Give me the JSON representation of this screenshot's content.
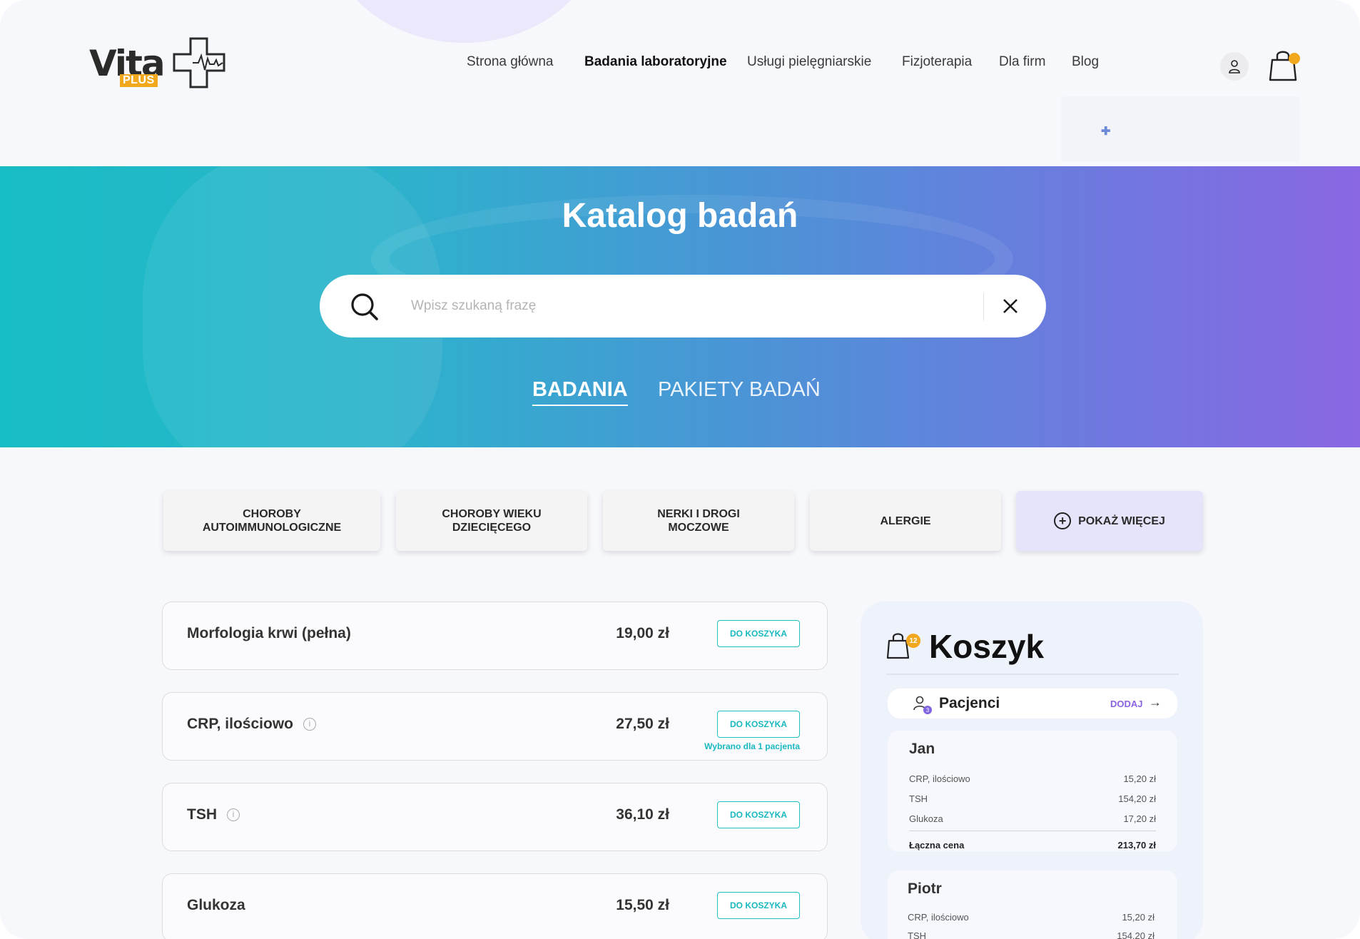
{
  "brand": {
    "name": "Vita",
    "sub": "PLUS"
  },
  "nav": {
    "items": [
      {
        "label": "Strona główna"
      },
      {
        "label": "Badania laboratoryjne"
      },
      {
        "label": "Usługi pielęgniarskie"
      },
      {
        "label": "Fizjoterapia"
      },
      {
        "label": "Dla firm"
      },
      {
        "label": "Blog"
      }
    ],
    "active_index": 1
  },
  "icons": {
    "user": "user-icon",
    "cart": "shopping-bag-icon",
    "search": "search-icon",
    "clear": "close-icon",
    "info": "info-icon",
    "add": "plus-circle-icon",
    "patients": "users-icon",
    "arrow": "arrow-right-icon"
  },
  "colors": {
    "accent_teal": "#1fc0c6",
    "accent_purple": "#8a63e3",
    "badge_orange": "#f2a81d"
  },
  "hero": {
    "title_light": "Katalog",
    "title_bold": "badań"
  },
  "search": {
    "placeholder": "Wpisz szukaną frazę",
    "value": ""
  },
  "tabs": [
    {
      "label": "BADANIA",
      "active": true
    },
    {
      "label": "PAKIETY BADAŃ",
      "active": false
    }
  ],
  "categories": [
    {
      "line1": "CHOROBY",
      "line2": "AUTOIMMUNOLOGICZNE"
    },
    {
      "line1": "CHOROBY WIEKU",
      "line2": "DZIECIĘCEGO"
    },
    {
      "line1": "NERKI I DROGI",
      "line2": "MOCZOWE"
    },
    {
      "line1": "ALERGIE",
      "line2": ""
    }
  ],
  "show_more": {
    "label": "POKAŻ WIĘCEJ"
  },
  "products": [
    {
      "name": "Morfologia krwi (pełna)",
      "price": "19,00 zł",
      "button": "DO KOSZYKA",
      "note": "",
      "info": false
    },
    {
      "name": "CRP, ilościowo",
      "price": "27,50 zł",
      "button": "DO KOSZYKA",
      "note": "Wybrano dla 1 pacjenta",
      "info": true
    },
    {
      "name": "TSH",
      "price": "36,10 zł",
      "button": "DO KOSZYKA",
      "note": "",
      "info": true
    },
    {
      "name": "Glukoza",
      "price": "15,50 zł",
      "button": "DO KOSZYKA",
      "note": "",
      "info": false
    }
  ],
  "cart": {
    "title": "Koszyk",
    "badge": "12",
    "patients_label": "Pacjenci",
    "patients_badge": "3",
    "add_label": "DODAJ",
    "patients": [
      {
        "name": "Jan",
        "items": [
          {
            "name": "CRP, ilościowo",
            "price": "15,20 zł"
          },
          {
            "name": "TSH",
            "price": "154,20 zł"
          },
          {
            "name": "Glukoza",
            "price": "17,20 zł"
          }
        ],
        "total_label": "Łączna cena",
        "total": "213,70 zł"
      },
      {
        "name": "Piotr",
        "items": [
          {
            "name": "CRP, ilościowo",
            "price": "15,20 zł"
          },
          {
            "name": "TSH",
            "price": "154,20 zł"
          }
        ]
      }
    ]
  }
}
